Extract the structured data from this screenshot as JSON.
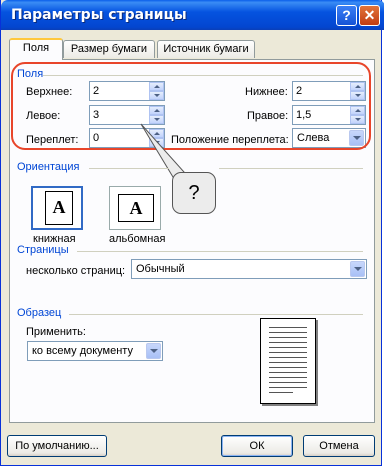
{
  "window": {
    "title": "Параметры страницы",
    "help_label": "?"
  },
  "tabs": [
    {
      "label": "Поля"
    },
    {
      "label": "Размер бумаги"
    },
    {
      "label": "Источник бумаги"
    }
  ],
  "margins": {
    "group_label": "Поля",
    "top": {
      "label": "Верхнее:",
      "value": "2"
    },
    "bottom": {
      "label": "Нижнее:",
      "value": "2"
    },
    "left": {
      "label": "Левое:",
      "value": "3"
    },
    "right": {
      "label": "Правое:",
      "value": "1,5"
    },
    "gutter": {
      "label": "Переплет:",
      "value": "0"
    },
    "gutter_position": {
      "label": "Положение переплета:",
      "value": "Слева"
    }
  },
  "callout": {
    "text": "?"
  },
  "orientation": {
    "group_label": "Ориентация",
    "portrait_label": "книжная",
    "landscape_label": "альбомная",
    "icon_letter": "A"
  },
  "pages": {
    "group_label": "Страницы",
    "multiple_label": "несколько страниц:",
    "multiple_value": "Обычный"
  },
  "sample": {
    "group_label": "Образец",
    "apply_label": "Применить:",
    "apply_value": "ко всему документу"
  },
  "buttons": {
    "default_label": "По умолчанию...",
    "ok_label": "ОК",
    "cancel_label": "Отмена"
  }
}
